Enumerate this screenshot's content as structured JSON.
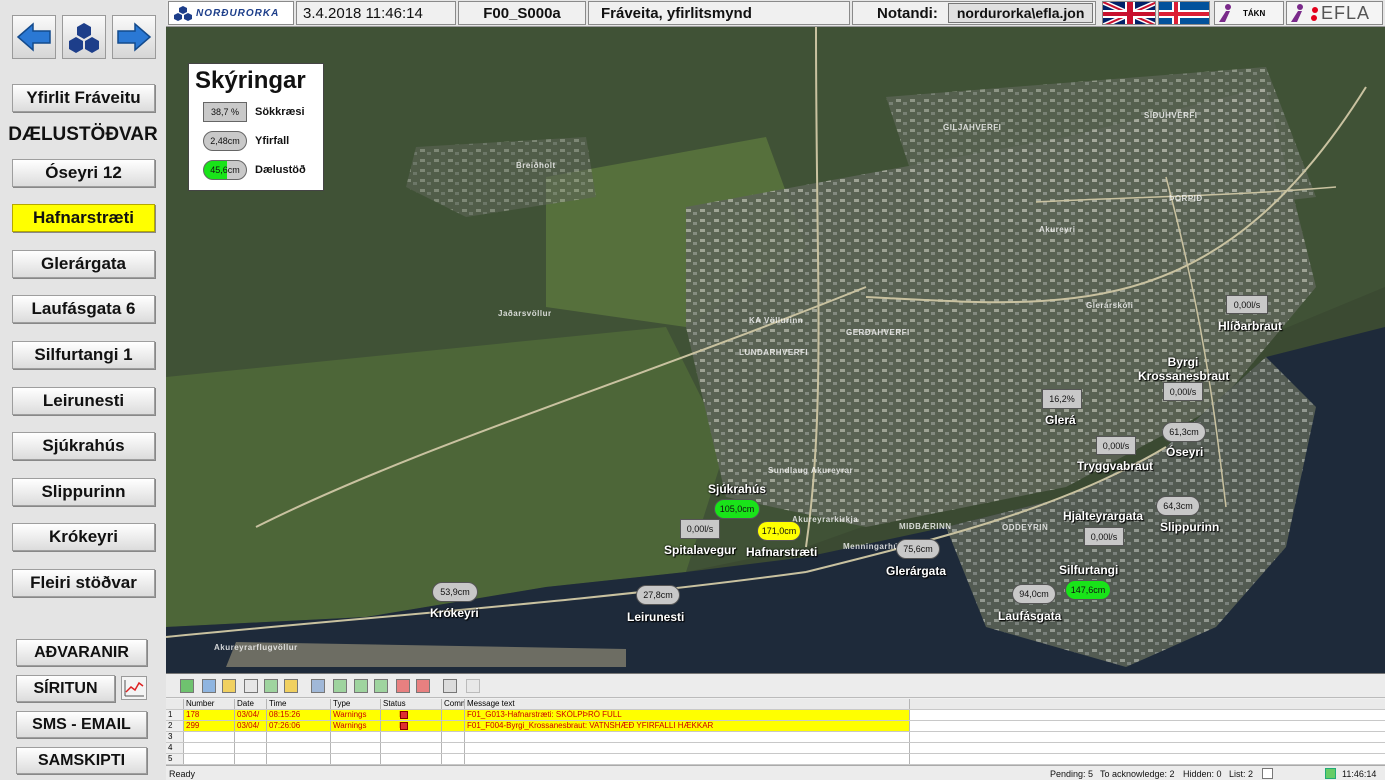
{
  "topbar": {
    "logo": "NORÐURORKA",
    "datetime": "3.4.2018 11:46:14",
    "screen_id": "F00_S000a",
    "screen_title": "Fráveita, yfirlitsmynd",
    "user_label": "Notandi:",
    "user_value": "nordurorka\\efla.jon",
    "takn_label": "TÁKN",
    "brand": "EFLA"
  },
  "sidebar": {
    "overview_button": "Yfirlit Fráveitu",
    "section_title": "DÆLUSTÖÐVAR",
    "stations": [
      "Óseyri 12",
      "Hafnarstræti",
      "Glerárgata",
      "Laufásgata 6",
      "Silfurtangi 1",
      "Leirunesti",
      "Sjúkrahús",
      "Slippurinn",
      "Krókeyri",
      "Fleiri stöðvar"
    ],
    "bottom": {
      "warnings": "AÐVARANIR",
      "trends": "SÍRITUN",
      "sms": "SMS - EMAIL",
      "comms": "SAMSKIPTI"
    }
  },
  "legend": {
    "title": "Skýringar",
    "rows": [
      {
        "value": "38,7 %",
        "label": "Sökkræsi"
      },
      {
        "value": "2,48cm",
        "label": "Yfirfall"
      },
      {
        "value": "45,6cm",
        "label": "Dælustöð"
      }
    ]
  },
  "map": {
    "places": [
      "Breiðholt",
      "Jaðarsvöllur",
      "KA Völlurinn",
      "LUNDARHVERFI",
      "GERÐAHVERFI",
      "GILJAHVERFI",
      "SÍÐUHVERFI",
      "ÞORPIÐ",
      "Akureyri",
      "Glerárskóli",
      "Sundlaug Akureyrar",
      "Akureyrarkirkja",
      "MIÐBÆRINN",
      "ODDEYRIN",
      "Akureyrarflugvöllur",
      "Menningarhús"
    ],
    "stations": [
      {
        "value": "0,00l/s",
        "label": "Hlíðarbraut"
      },
      {
        "value": "0,00l/s",
        "label": "Byrgi Krossanesbraut"
      },
      {
        "value": "16,2%",
        "label": "Glerá"
      },
      {
        "value": "0,00l/s",
        "label": "Tryggvabraut"
      },
      {
        "value": "61,3cm",
        "label": "Óseyri"
      },
      {
        "value": "64,3cm",
        "label": "Slippurinn"
      },
      {
        "value": "0,00l/s",
        "label": "Hjalteyrargata"
      },
      {
        "value": "105,0cm",
        "label": "Sjúkrahús"
      },
      {
        "value": "171,0cm",
        "label": "Hafnarstræti"
      },
      {
        "value": "0,00l/s",
        "label": "Spitalavegur"
      },
      {
        "value": "75,6cm",
        "label": "Glerárgata"
      },
      {
        "value": "147,6cm",
        "label": "Silfurtangi"
      },
      {
        "value": "94,0cm",
        "label": "Laufásgata"
      },
      {
        "value": "53,9cm",
        "label": "Krókeyri"
      },
      {
        "value": "27,8cm",
        "label": "Leirunesti"
      }
    ]
  },
  "alarms": {
    "headers": [
      "Number",
      "Date",
      "Time",
      "Type",
      "Status",
      "Comm",
      "Message text"
    ],
    "rows": [
      {
        "idx": "1",
        "number": "178",
        "date": "03/04/",
        "time": "08:15:26",
        "type": "Warnings",
        "status": "In",
        "comm": "",
        "message": "F01_G013-Hafnarstræti: SKÓLPÞRÓ FULL"
      },
      {
        "idx": "2",
        "number": "299",
        "date": "03/04/",
        "time": "07:26:06",
        "type": "Warnings",
        "status": "In",
        "comm": "",
        "message": "F01_F004-Byrgi_Krossanesbraut: VATNSHÆÐ YFIRFALLI HÆKKAR"
      }
    ],
    "empty_rows": [
      "3",
      "4",
      "5"
    ],
    "status": {
      "ready": "Ready",
      "pending": "Pending: 5",
      "ack": "To acknowledge: 2",
      "hidden": "Hidden: 0",
      "list": "List: 2",
      "time": "11:46:14"
    }
  },
  "colors": {
    "alarm_row": "#ffff00",
    "alarm_text": "#cc0000",
    "station_green": "#19e319",
    "station_yellow": "#ffff00",
    "button_active": "#ffff00"
  }
}
